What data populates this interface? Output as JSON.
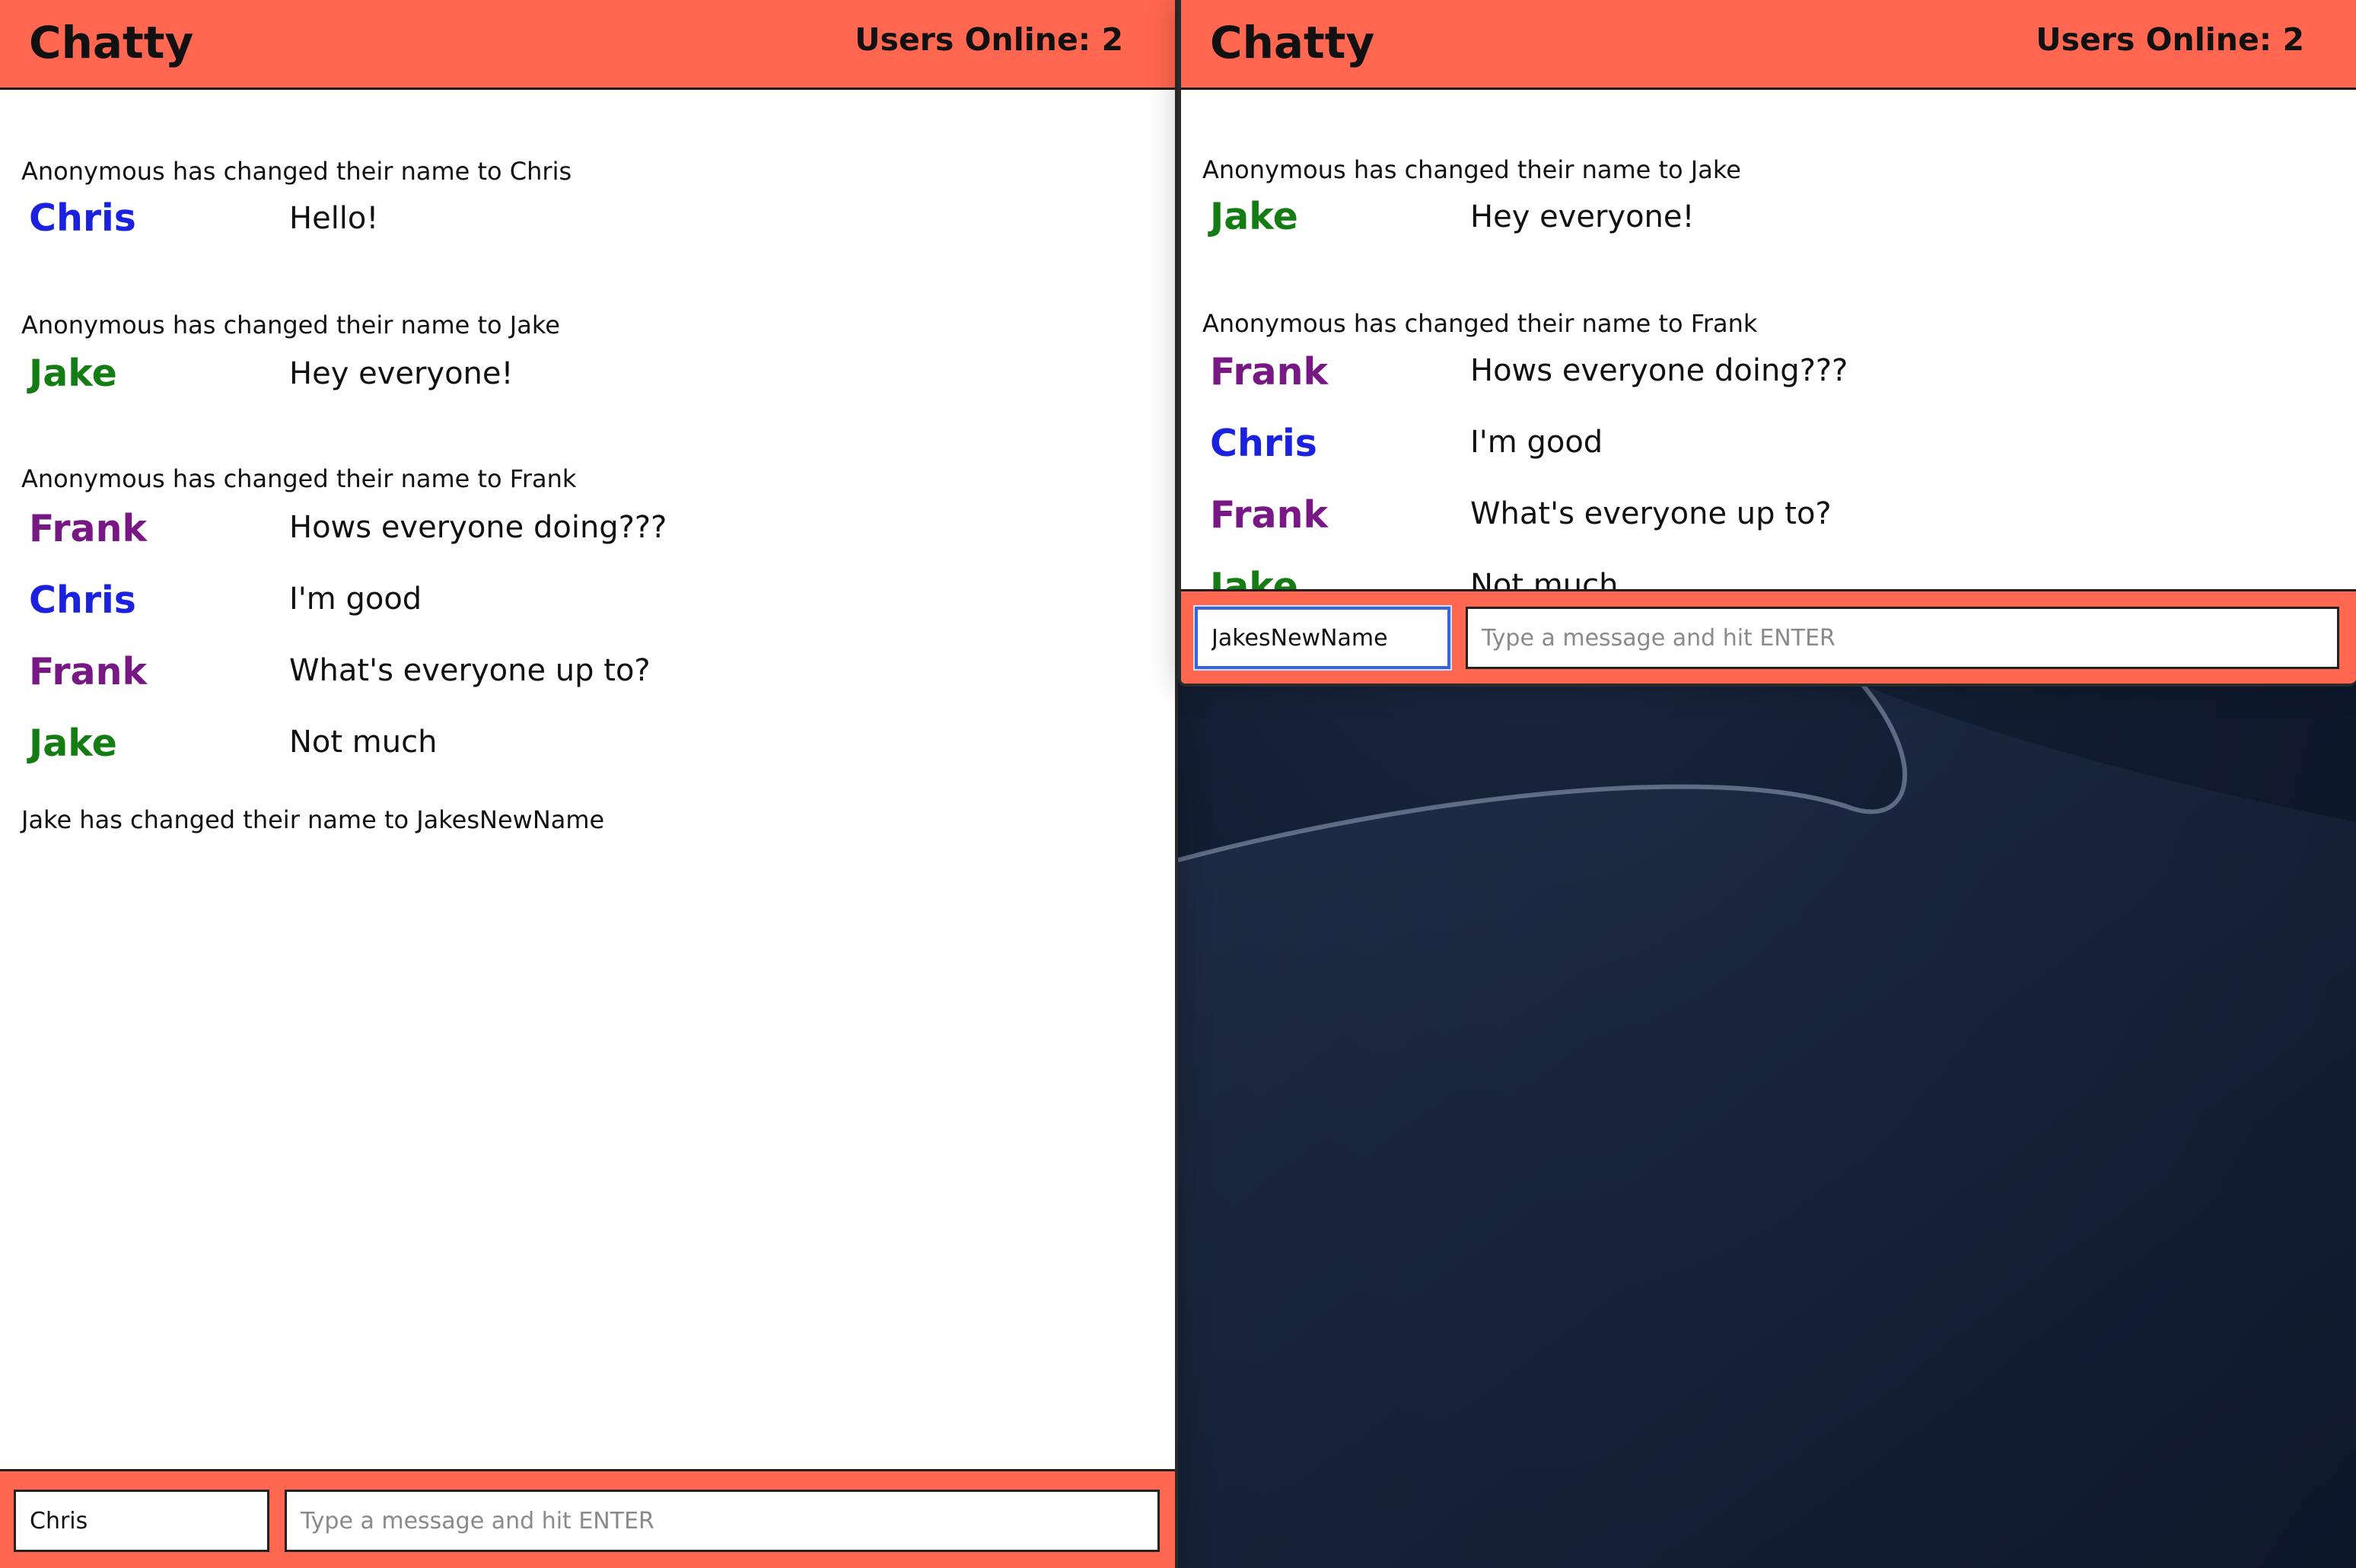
{
  "colors": {
    "navbar": "#ff6750",
    "chris": "#1a22e0",
    "jake": "#137d13",
    "frank": "#781885"
  },
  "left_window": {
    "brand": "Chatty",
    "users_online": "Users Online: 2",
    "messages": [
      {
        "type": "notice",
        "text": "Anonymous has changed their name to Chris"
      },
      {
        "type": "message",
        "user": "Chris",
        "color": "#1a22e0",
        "text": "Hello!"
      },
      {
        "type": "notice",
        "text": "Anonymous has changed their name to Jake"
      },
      {
        "type": "message",
        "user": "Jake",
        "color": "#137d13",
        "text": "Hey everyone!"
      },
      {
        "type": "notice",
        "text": "Anonymous has changed their name to Frank"
      },
      {
        "type": "message",
        "user": "Frank",
        "color": "#781885",
        "text": "Hows everyone doing???"
      },
      {
        "type": "message",
        "user": "Chris",
        "color": "#1a22e0",
        "text": "I'm good"
      },
      {
        "type": "message",
        "user": "Frank",
        "color": "#781885",
        "text": "What's everyone up to?"
      },
      {
        "type": "message",
        "user": "Jake",
        "color": "#137d13",
        "text": "Not much"
      },
      {
        "type": "notice",
        "text": "Jake has changed their name to JakesNewName"
      }
    ],
    "name_value": "Chris",
    "message_placeholder": "Type a message and hit ENTER"
  },
  "right_window": {
    "brand": "Chatty",
    "users_online": "Users Online: 2",
    "messages": [
      {
        "type": "notice",
        "text": "Anonymous has changed their name to Jake"
      },
      {
        "type": "message",
        "user": "Jake",
        "color": "#137d13",
        "text": "Hey everyone!"
      },
      {
        "type": "notice",
        "text": "Anonymous has changed their name to Frank"
      },
      {
        "type": "message",
        "user": "Frank",
        "color": "#781885",
        "text": "Hows everyone doing???"
      },
      {
        "type": "message",
        "user": "Chris",
        "color": "#1a22e0",
        "text": "I'm good"
      },
      {
        "type": "message",
        "user": "Frank",
        "color": "#781885",
        "text": "What's everyone up to?"
      },
      {
        "type": "message",
        "user": "Jake",
        "color": "#137d13",
        "text": "Not much"
      }
    ],
    "name_value": "JakesNewName",
    "message_placeholder": "Type a message and hit ENTER"
  }
}
